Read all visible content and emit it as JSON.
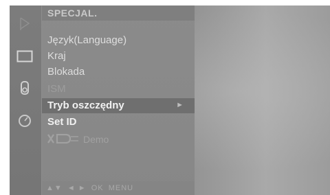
{
  "menu": {
    "title": "SPECJAL.",
    "items": [
      {
        "label": "Język(Language)"
      },
      {
        "label": "Kraj"
      },
      {
        "label": "Blokada"
      },
      {
        "label": "ISM"
      },
      {
        "label": "Tryb oszczędny",
        "arrow": "►"
      },
      {
        "label": "Set ID"
      }
    ],
    "demo": {
      "label": "Demo"
    }
  },
  "footer": {
    "nav_arrows": "▲▼",
    "lr_arrows": "◄ ►",
    "ok": "OK",
    "menu": "MENU"
  },
  "icons": {
    "strip": [
      "antenna-icon",
      "picture-icon",
      "speaker-icon",
      "clock-icon"
    ]
  }
}
